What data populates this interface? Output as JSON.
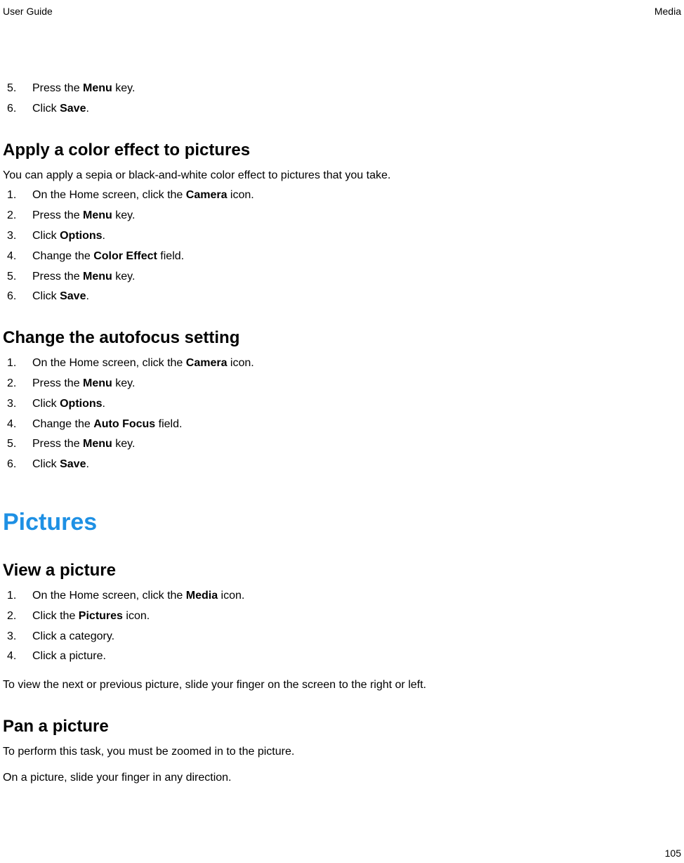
{
  "header": {
    "left": "User Guide",
    "right": "Media"
  },
  "footer": {
    "page": "105"
  },
  "topSteps": [
    {
      "n": "5.",
      "html": "Press the <b>Menu</b> key."
    },
    {
      "n": "6.",
      "html": "Click <b>Save</b>."
    }
  ],
  "sections": [
    {
      "heading": "Apply a color effect to pictures",
      "intro": "You can apply a sepia or black-and-white color effect to pictures that you take.",
      "steps": [
        {
          "n": "1.",
          "html": "On the Home screen, click the <b>Camera</b> icon."
        },
        {
          "n": "2.",
          "html": "Press the <b>Menu</b> key."
        },
        {
          "n": "3.",
          "html": "Click <b>Options</b>."
        },
        {
          "n": "4.",
          "html": "Change the <b>Color Effect</b> field."
        },
        {
          "n": "5.",
          "html": "Press the <b>Menu</b> key."
        },
        {
          "n": "6.",
          "html": "Click <b>Save</b>."
        }
      ]
    },
    {
      "heading": "Change the autofocus setting",
      "steps": [
        {
          "n": "1.",
          "html": "On the Home screen, click the <b>Camera</b> icon."
        },
        {
          "n": "2.",
          "html": "Press the <b>Menu</b> key."
        },
        {
          "n": "3.",
          "html": "Click <b>Options</b>."
        },
        {
          "n": "4.",
          "html": "Change the <b>Auto Focus</b> field."
        },
        {
          "n": "5.",
          "html": "Press the <b>Menu</b> key."
        },
        {
          "n": "6.",
          "html": "Click <b>Save</b>."
        }
      ]
    }
  ],
  "chapter": "Pictures",
  "picSections": [
    {
      "heading": "View a picture",
      "steps": [
        {
          "n": "1.",
          "html": "On the Home screen, click the <b>Media</b> icon."
        },
        {
          "n": "2.",
          "html": "Click the <b>Pictures</b> icon."
        },
        {
          "n": "3.",
          "html": "Click a category."
        },
        {
          "n": "4.",
          "html": "Click a picture."
        }
      ],
      "after": "To view the next or previous picture, slide your finger on the screen to the right or left."
    },
    {
      "heading": "Pan a picture",
      "intro": "To perform this task, you must be zoomed in to the picture.",
      "after": "On a picture, slide your finger in any direction."
    }
  ]
}
